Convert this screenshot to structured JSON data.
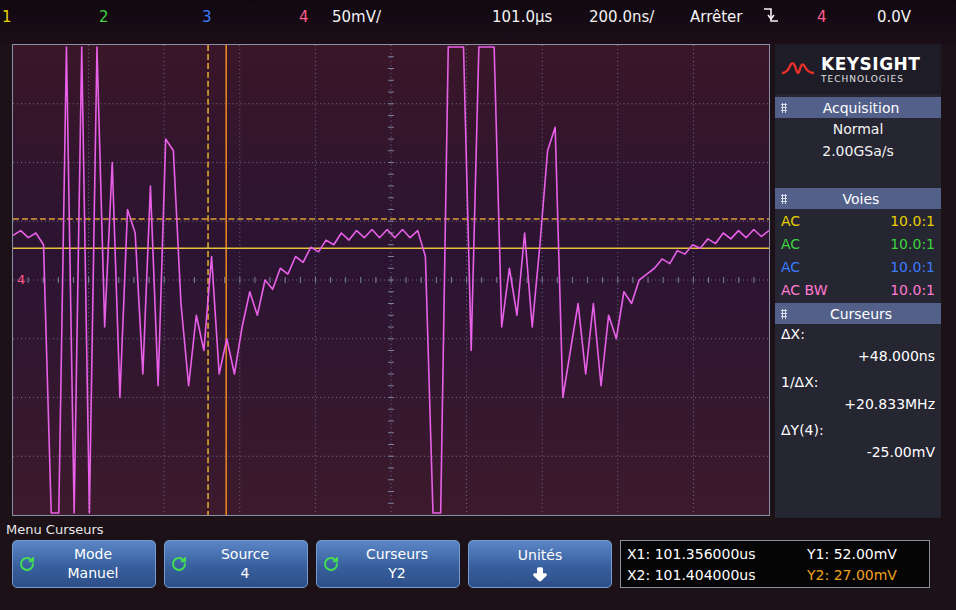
{
  "top_bar": {
    "channels": [
      {
        "label": "1",
        "color": "#e8d000"
      },
      {
        "label": "2",
        "color": "#3ed43e"
      },
      {
        "label": "3",
        "color": "#3a7cff"
      },
      {
        "label": "4",
        "color": "#ff5a8a"
      }
    ],
    "vertical_scale": "50mV/",
    "delay": "101.0µs",
    "timebase": "200.0ns/",
    "run_state": "Arrêter",
    "trigger_source": "4",
    "trigger_level": "0.0V"
  },
  "logo": {
    "name": "KEYSIGHT",
    "subtitle": "TECHNOLOGIES"
  },
  "acquisition": {
    "title": "Acquisition",
    "mode": "Normal",
    "rate": "2.00GSa/s"
  },
  "channels_panel": {
    "title": "Voies",
    "rows": [
      {
        "coupling": "AC",
        "probe": "10.0:1",
        "color": "#e8d000"
      },
      {
        "coupling": "AC",
        "probe": "10.0:1",
        "color": "#3ed43e"
      },
      {
        "coupling": "AC",
        "probe": "10.0:1",
        "color": "#3a7cff"
      },
      {
        "coupling": "AC BW",
        "probe": "10.0:1",
        "color": "#ff7ad0"
      }
    ]
  },
  "cursors_panel": {
    "title": "Curseurs",
    "readings": [
      {
        "label": "ΔX:",
        "value": "+48.000ns"
      },
      {
        "label": "1/ΔX:",
        "value": "+20.833MHz"
      },
      {
        "label": "ΔY(4):",
        "value": "-25.00mV"
      }
    ]
  },
  "waveform": {
    "ground_label": "4",
    "color": "#e860e8",
    "values_mv": [
      38,
      42,
      36,
      40,
      30,
      -200,
      -200,
      200,
      -200,
      200,
      -200,
      200,
      -40,
      100,
      -100,
      60,
      40,
      -80,
      80,
      -90,
      120,
      110,
      -20,
      -90,
      -30,
      -60,
      20,
      -80,
      -50,
      -80,
      -40,
      -10,
      -30,
      0,
      -8,
      10,
      5,
      20,
      15,
      28,
      24,
      34,
      30,
      40,
      34,
      42,
      36,
      43,
      36,
      43,
      36,
      43,
      36,
      42,
      20,
      -200,
      -200,
      200,
      200,
      200,
      -60,
      200,
      200,
      200,
      -40,
      10,
      -30,
      40,
      -40,
      30,
      110,
      130,
      -100,
      -60,
      -20,
      -80,
      -20,
      -90,
      -30,
      -50,
      -10,
      -20,
      0,
      5,
      10,
      18,
      14,
      25,
      22,
      30,
      27,
      35,
      31,
      40,
      35,
      42,
      36,
      43,
      37,
      42
    ]
  },
  "cursors": [
    {
      "axis": "x",
      "value": 101.356,
      "color": "#e8b030",
      "dashed": true
    },
    {
      "axis": "x",
      "value": 101.404,
      "color": "#f08a20",
      "dashed": false
    },
    {
      "axis": "y",
      "value": 52,
      "color": "#e0a030",
      "dashed": true
    },
    {
      "axis": "y",
      "value": 27,
      "color": "#e8c040",
      "dashed": false
    }
  ],
  "menu": {
    "title": "Menu Curseurs",
    "softkeys": [
      {
        "label": "Mode",
        "value": "Manuel",
        "kind": "toggle"
      },
      {
        "label": "Source",
        "value": "4",
        "kind": "toggle"
      },
      {
        "label": "Curseurs",
        "value": "Y2",
        "kind": "toggle"
      },
      {
        "label": "Unités",
        "value": "",
        "kind": "submenu"
      }
    ],
    "readout": [
      {
        "label": "X1:",
        "value": "101.356000us",
        "color": "#ffffff"
      },
      {
        "label": "X2:",
        "value": "101.404000us",
        "color": "#ffffff"
      },
      {
        "label": "Y1:",
        "value": "52.00mV",
        "color": "#ffffff"
      },
      {
        "label": "Y2:",
        "value": "27.00mV",
        "color": "#f0a020"
      }
    ]
  }
}
